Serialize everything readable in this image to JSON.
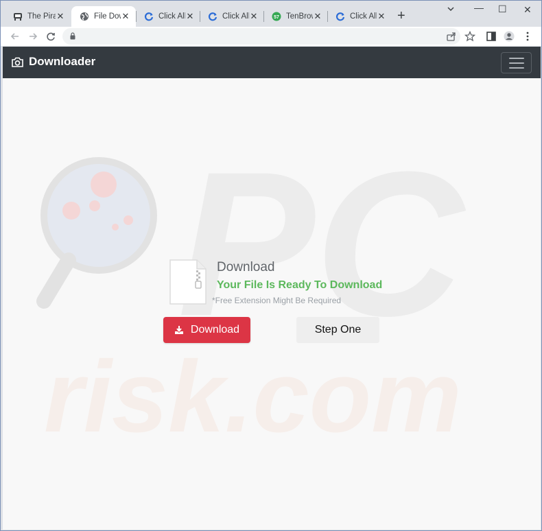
{
  "browser": {
    "tabs": [
      {
        "title": "The Pirat",
        "icon": "pirate-icon",
        "active": false
      },
      {
        "title": "File Dowr",
        "icon": "globe-icon",
        "active": true
      },
      {
        "title": "Click Allo",
        "icon": "refresh-logo-icon",
        "active": false
      },
      {
        "title": "Click Allo",
        "icon": "refresh-logo-icon",
        "active": false
      },
      {
        "title": "TenBrows",
        "icon": "tenbrowser-icon",
        "active": false
      },
      {
        "title": "Click Allo",
        "icon": "refresh-logo-icon",
        "active": false
      }
    ],
    "new_tab_label": "+",
    "window_controls": {
      "minimize": "—",
      "maximize": "☐",
      "close": "✕"
    },
    "address": ""
  },
  "navbar": {
    "brand": "Downloader",
    "brand_icon": "camera-icon"
  },
  "main": {
    "heading": "Download",
    "ready_text": "Your File Is Ready To Download",
    "note": "*Free Extension Might Be Required",
    "download_button": "Download",
    "step_button": "Step One"
  },
  "watermark": {
    "line1": "PC",
    "line2": "risk.com"
  },
  "colors": {
    "navbar_bg": "#343a40",
    "accent_red": "#dc3545",
    "ready_green": "#5cb85c",
    "page_bg": "#f8f8f8"
  }
}
